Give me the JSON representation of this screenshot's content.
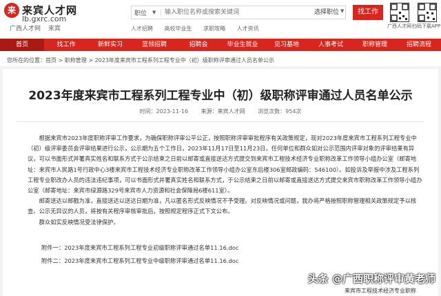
{
  "header": {
    "logo_mark": "来",
    "logo_name": "来宾人才网",
    "logo_domain": "lb.gxrc.com",
    "logo_sub": [
      "广西人才网",
      "来宾"
    ],
    "search_type": "职位",
    "search_placeholder": "输入职位名称或搜索关键词",
    "search_select": "选择职位",
    "find_label": "找工作",
    "tags": [
      "人才招聘",
      "高校毕业生",
      "求职攻略",
      "人才资讯"
    ],
    "qr_labels": [
      "广西人才网",
      "扫码下载APP"
    ]
  },
  "nav": {
    "items": [
      "首页",
      "找工作",
      "新鲜实习",
      "蓝领招聘",
      "招聘会",
      "毕业生就业",
      "见习基地",
      "人事考试",
      "职称管理",
      "招聘流程"
    ]
  },
  "breadcrumb": {
    "text": "您所在的位置：首页 > 职称管理 > 2023年度来宾市工程系列工程专业中（初）级职称评审通过人员名单公示"
  },
  "article": {
    "title": "2023年度来宾市工程系列工程专业中（初）级职称评审通过人员名单公示",
    "source": "来源：",
    "date": "时间：2023-11-16",
    "author": "来源：来宾人才网",
    "views": "浏览次数：954次",
    "paragraphs": [
      "根据来宾市2023年度职称评审工作要求，为确保职称评审公平公正，按照职称评审审批程序有关政策规定，现对2023年度来宾市工程系列工程专业中（初）级评审委员会评审结果进行公示，公示期为五个工作日，2023年11月17日至11月23日。任何单位和群众如对公示范围内评审对象的评审结果有异议，可以书面形式并署真实姓名和联系方式于公示结束之日前以邮寄或直接送达方式提交到来宾市工程技术经济专业职称改革工作领导小组办公室（邮寄地址：来宾市人民路1号行政中心3楼来宾市工程技术经济专业职称改革工作领导小组办公室东后楼306室邮政编码：546100）。如投诉及举报中涉及工程系列工程专业职改办人员的违法违纪事项，可以书面形式并署真实姓名和联系方式，于公示结束之日前以邮寄或直接送达方式提交来宾市职称改革工作领导小组办公室（邮寄地址：来宾市绿源路329号来宾市人力资源和社会保障局6楼611室）。",
      "邮寄送达以邮戳为准，直接送达以送达日期为准，凡以匿名形式反映情况不予受理。对反映情况或问题，我办将严格按照职称管理相关政策规定予以核查。公示无异议的人员，将按有关程序审核审批后，按照规定程序正式下文公布。",
      "群众如实反映情况受法律保护。"
    ],
    "attachments": [
      "附件一：2023年度来宾市工程系列工程专业初级职称评审通过名单11.16.doc",
      "附件二：2023年度来宾市工程系列工程专业中级职称评审通过名单11.16.doc"
    ]
  },
  "watermark": {
    "main": "头条 @广西职称评审黄老师",
    "sub": "来宾市工程技术经济专业职称"
  }
}
